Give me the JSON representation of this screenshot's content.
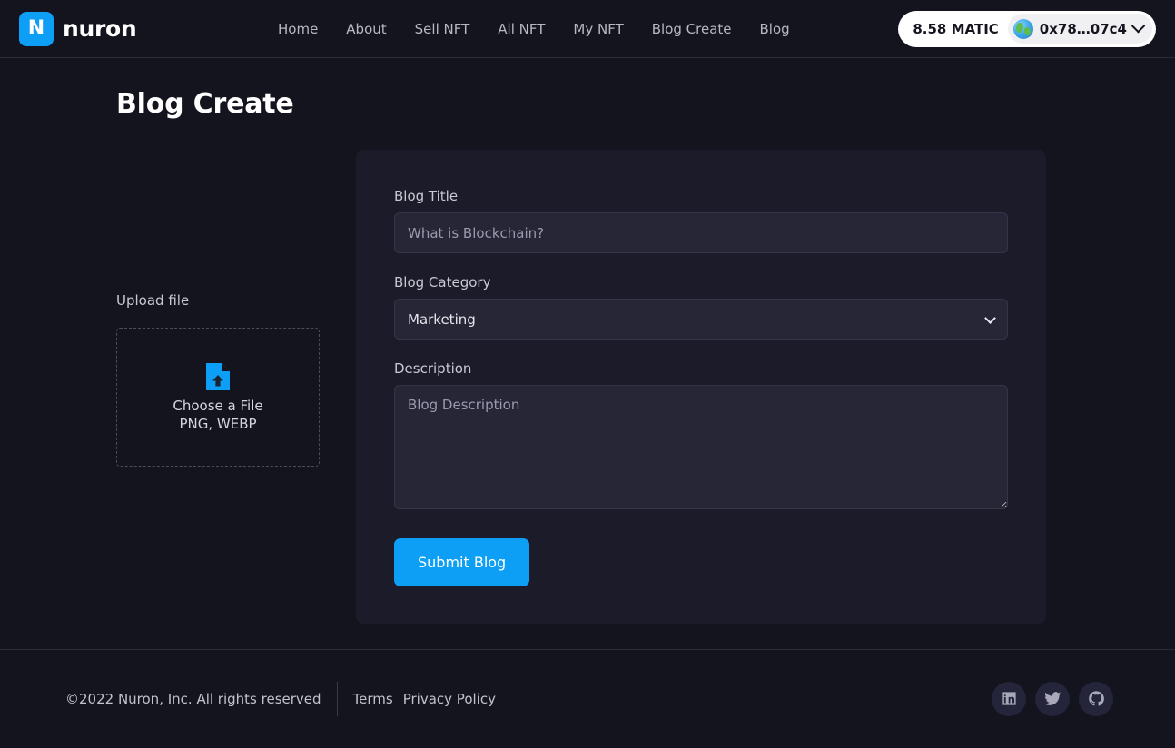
{
  "header": {
    "logo_letter": "N",
    "brand_name": "nuron",
    "nav": [
      {
        "label": "Home"
      },
      {
        "label": "About"
      },
      {
        "label": "Sell NFT"
      },
      {
        "label": "All NFT"
      },
      {
        "label": "My NFT"
      },
      {
        "label": "Blog Create"
      },
      {
        "label": "Blog"
      }
    ],
    "wallet": {
      "balance": "8.58 MATIC",
      "network_icon": "globe-icon",
      "address": "0x78…07c4",
      "chevron_icon": "chevron-down-icon"
    }
  },
  "page": {
    "title": "Blog Create"
  },
  "upload": {
    "label": "Upload file",
    "icon": "file-upload-icon",
    "choose_text": "Choose a File",
    "formats_text": "PNG, WEBP"
  },
  "form": {
    "title": {
      "label": "Blog Title",
      "value": "",
      "placeholder": "What is Blockchain?"
    },
    "category": {
      "label": "Blog Category",
      "selected": "Marketing",
      "options": [
        "Marketing"
      ],
      "chevron_icon": "chevron-down-icon"
    },
    "description": {
      "label": "Description",
      "value": "",
      "placeholder": "Blog Description"
    },
    "submit_label": "Submit Blog"
  },
  "footer": {
    "copyright": "©2022 Nuron, Inc. All rights reserved",
    "links": [
      {
        "label": "Terms"
      },
      {
        "label": "Privacy Policy"
      }
    ],
    "socials": [
      {
        "name": "linkedin-icon"
      },
      {
        "name": "twitter-icon"
      },
      {
        "name": "github-icon"
      }
    ]
  },
  "colors": {
    "background": "#14141f",
    "card": "#1b1b2a",
    "accent": "#0d9ff5",
    "input": "#262637",
    "text_muted": "#c9c9d4"
  }
}
